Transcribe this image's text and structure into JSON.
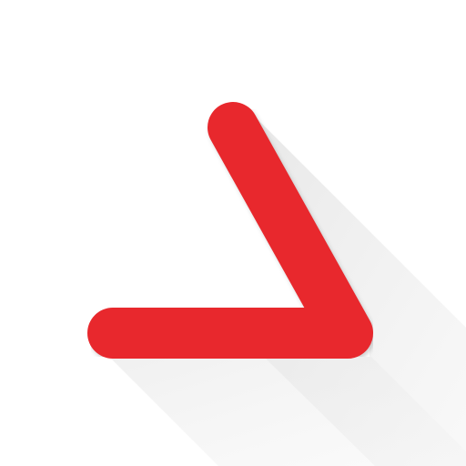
{
  "icon": {
    "name": "chevron-check-icon",
    "color": "#e8282d",
    "shadow_color": "#e9e9e9",
    "background": "#ffffff"
  }
}
